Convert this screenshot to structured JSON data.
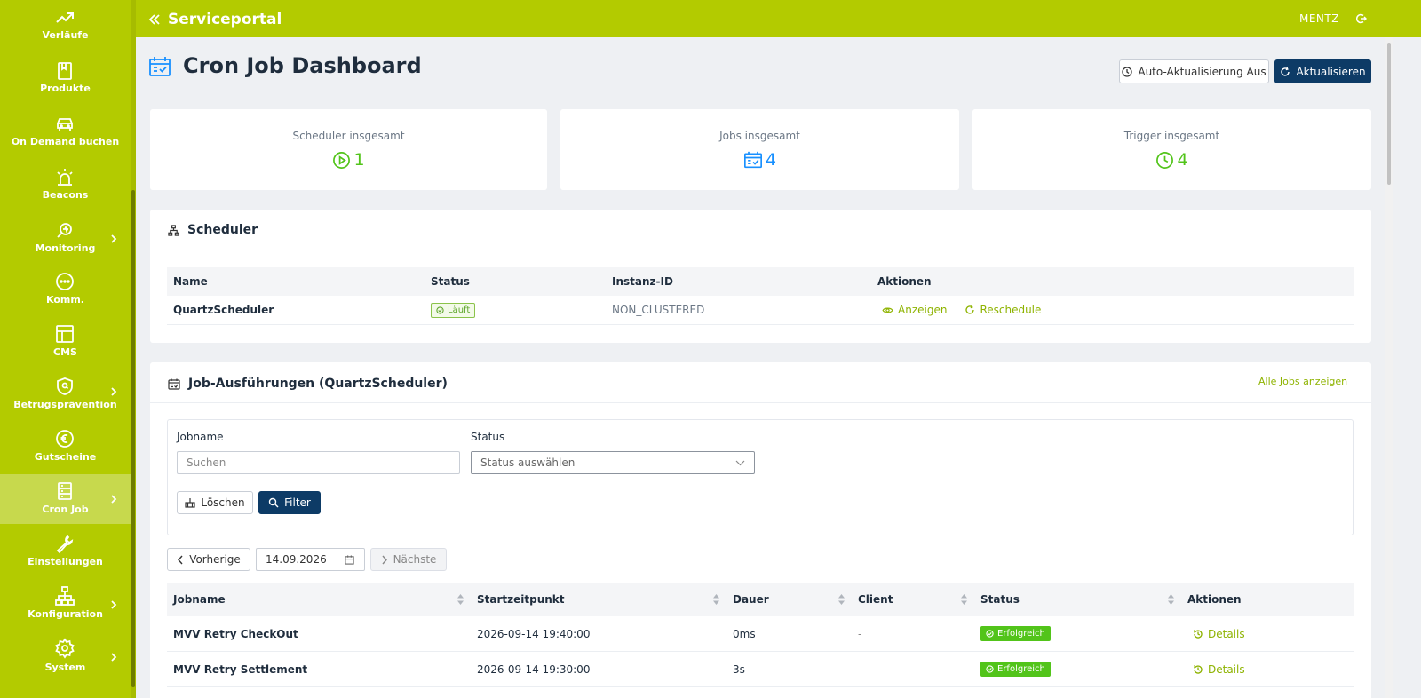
{
  "sidebar": {
    "items": [
      {
        "label": "Verläufe",
        "icon": "trend-icon",
        "chevron": false,
        "active": false
      },
      {
        "label": "Produkte",
        "icon": "bookmark-icon",
        "chevron": false,
        "active": false
      },
      {
        "label": "On Demand buchen",
        "icon": "car-icon",
        "chevron": false,
        "active": false
      },
      {
        "label": "Beacons",
        "icon": "beacon-icon",
        "chevron": false,
        "active": false
      },
      {
        "label": "Monitoring",
        "icon": "monitoring-icon",
        "chevron": true,
        "active": false
      },
      {
        "label": "Komm.",
        "icon": "chat-icon",
        "chevron": false,
        "active": false
      },
      {
        "label": "CMS",
        "icon": "layout-icon",
        "chevron": false,
        "active": false
      },
      {
        "label": "Betrugsprävention",
        "icon": "shield-icon",
        "chevron": true,
        "active": false
      },
      {
        "label": "Gutscheine",
        "icon": "euro-icon",
        "chevron": false,
        "active": false
      },
      {
        "label": "Cron Job",
        "icon": "server-icon",
        "chevron": true,
        "active": true
      },
      {
        "label": "Einstellungen",
        "icon": "wrench-icon",
        "chevron": false,
        "active": false
      },
      {
        "label": "Konfiguration",
        "icon": "network-icon",
        "chevron": true,
        "active": false
      },
      {
        "label": "System",
        "icon": "gear-icon",
        "chevron": true,
        "active": false
      }
    ]
  },
  "header": {
    "brand": "Serviceportal",
    "user": "MENTZ"
  },
  "page": {
    "title": "Cron Job Dashboard",
    "auto_refresh_label": "Auto-Aktualisierung Aus",
    "refresh_label": "Aktualisieren"
  },
  "stats": [
    {
      "label": "Scheduler insgesamt",
      "value": "1",
      "icon": "play-circle-icon",
      "color": "#52c41a"
    },
    {
      "label": "Jobs insgesamt",
      "value": "4",
      "icon": "calendar-check-icon",
      "color": "#1890ff"
    },
    {
      "label": "Trigger insgesamt",
      "value": "4",
      "icon": "clock-icon",
      "color": "#52c41a"
    }
  ],
  "scheduler": {
    "title": "Scheduler",
    "columns": [
      "Name",
      "Status",
      "Instanz-ID",
      "Aktionen"
    ],
    "rows": [
      {
        "name": "QuartzScheduler",
        "status": "Läuft",
        "instance_id": "NON_CLUSTERED",
        "action_view": "Anzeigen",
        "action_reschedule": "Reschedule"
      }
    ]
  },
  "executions": {
    "title": "Job-Ausführungen (QuartzScheduler)",
    "all_jobs_link": "Alle Jobs anzeigen",
    "filter": {
      "jobname_label": "Jobname",
      "jobname_placeholder": "Suchen",
      "status_label": "Status",
      "status_placeholder": "Status auswählen",
      "clear_label": "Löschen",
      "filter_label": "Filter"
    },
    "pager": {
      "prev_label": "Vorherige",
      "date": "14.09.2026",
      "next_label": "Nächste"
    },
    "columns": [
      "Jobname",
      "Startzeitpunkt",
      "Dauer",
      "Client",
      "Status",
      "Aktionen"
    ],
    "rows": [
      {
        "jobname": "MVV Retry CheckOut",
        "start": "2026-09-14 19:40:00",
        "duration": "0ms",
        "client": "-",
        "status": "Erfolgreich",
        "action": "Details"
      },
      {
        "jobname": "MVV Retry Settlement",
        "start": "2026-09-14 19:30:00",
        "duration": "3s",
        "client": "-",
        "status": "Erfolgreich",
        "action": "Details"
      }
    ]
  },
  "colors": {
    "brand": "#b3cb00",
    "primary_dark": "#0d3b66",
    "success": "#52c41a",
    "link": "#8eb300"
  }
}
